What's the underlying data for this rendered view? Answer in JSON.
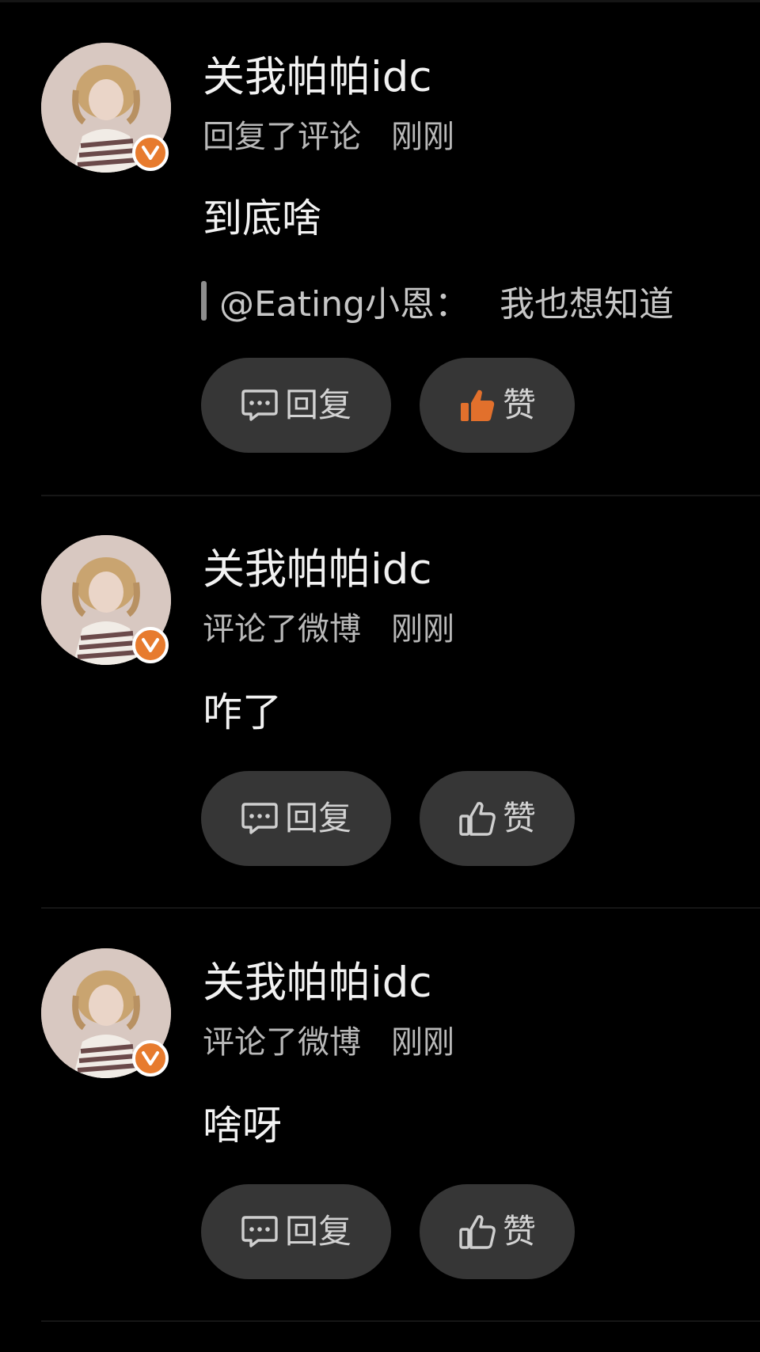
{
  "colors": {
    "background": "#000000",
    "button_bg": "#363636",
    "badge": "#e77b2e",
    "liked_thumb": "#e2702c"
  },
  "comments": [
    {
      "username": "关我帕帕idc",
      "action": "回复了评论",
      "time": "刚刚",
      "content": "到底啥",
      "quote": {
        "user": "@Eating小恩：",
        "text": "我也想知道"
      },
      "reply_label": "回复",
      "like_label": "赞",
      "liked": true,
      "badge_icon": "verified-v-icon"
    },
    {
      "username": "关我帕帕idc",
      "action": "评论了微博",
      "time": "刚刚",
      "content": "咋了",
      "reply_label": "回复",
      "like_label": "赞",
      "liked": false,
      "badge_icon": "verified-v-icon"
    },
    {
      "username": "关我帕帕idc",
      "action": "评论了微博",
      "time": "刚刚",
      "content": "啥呀",
      "reply_label": "回复",
      "like_label": "赞",
      "liked": false,
      "badge_icon": "verified-v-icon"
    }
  ]
}
